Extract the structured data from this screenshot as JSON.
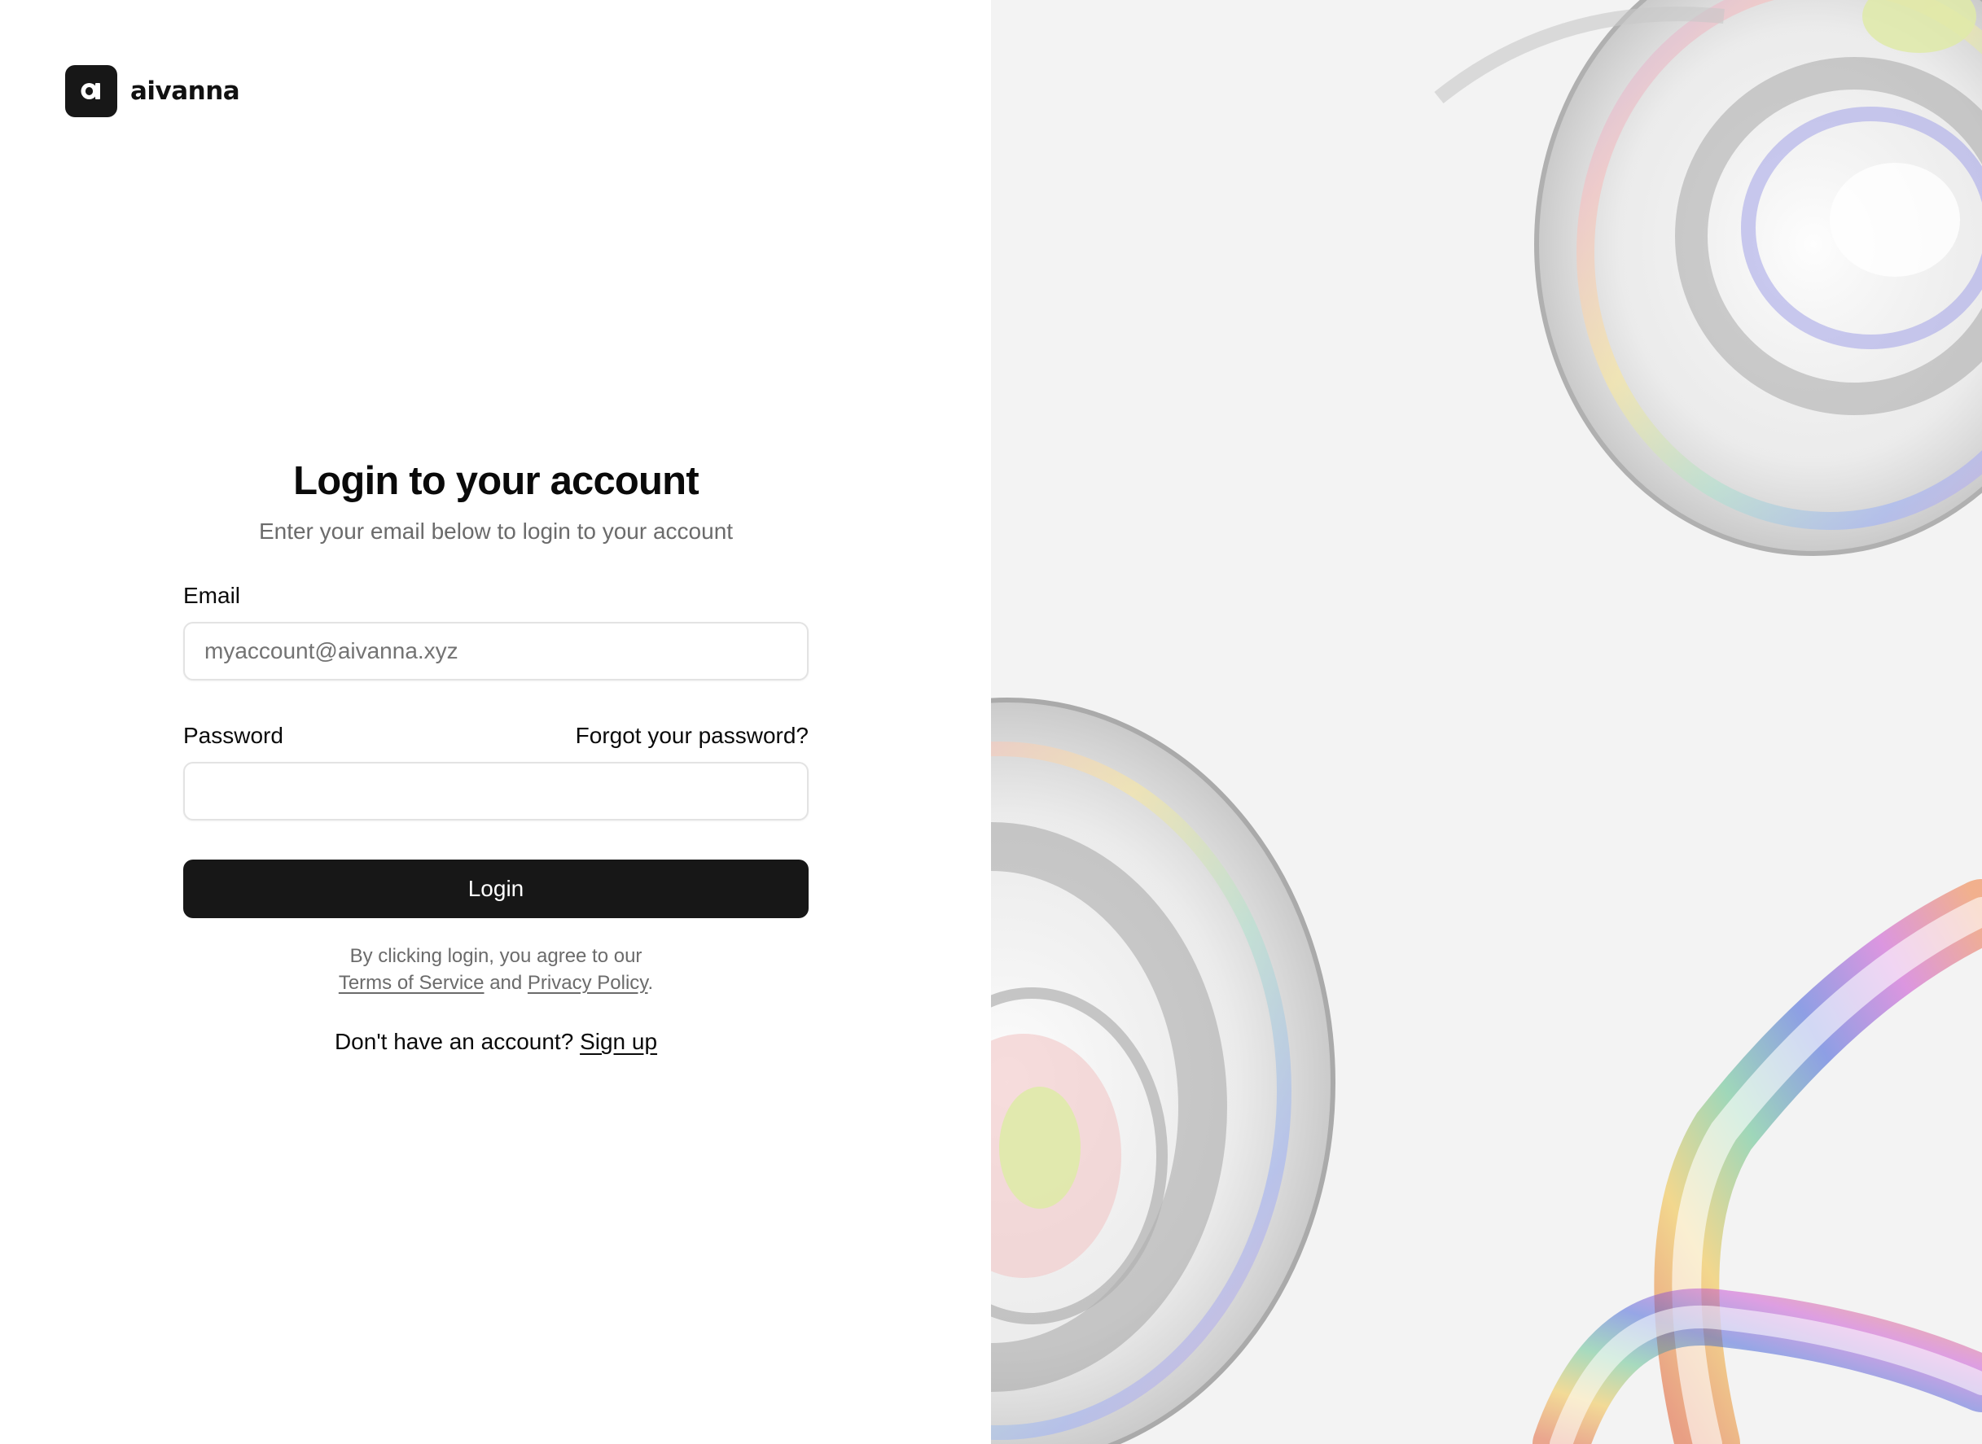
{
  "brand": {
    "logo_letter": "a",
    "name": "aivanna"
  },
  "login": {
    "title": "Login to your account",
    "subtitle": "Enter your email below to login to your account",
    "email": {
      "label": "Email",
      "placeholder": "myaccount@aivanna.xyz",
      "value": ""
    },
    "password": {
      "label": "Password",
      "forgot_link": "Forgot your password?",
      "value": ""
    },
    "submit_label": "Login",
    "legal": {
      "prefix": "By clicking login, you agree to our",
      "terms_link": "Terms of Service",
      "and": "and",
      "privacy_link": "Privacy Policy",
      "suffix": "."
    },
    "signup": {
      "prompt": "Don't have an account?",
      "link": "Sign up"
    }
  },
  "colors": {
    "primary_button": "#171717",
    "right_panel_bg": "#f3f3f3",
    "muted_text": "#6b6b6b"
  },
  "decor": {
    "right_panel_image": "iridescent-glass-shapes"
  }
}
